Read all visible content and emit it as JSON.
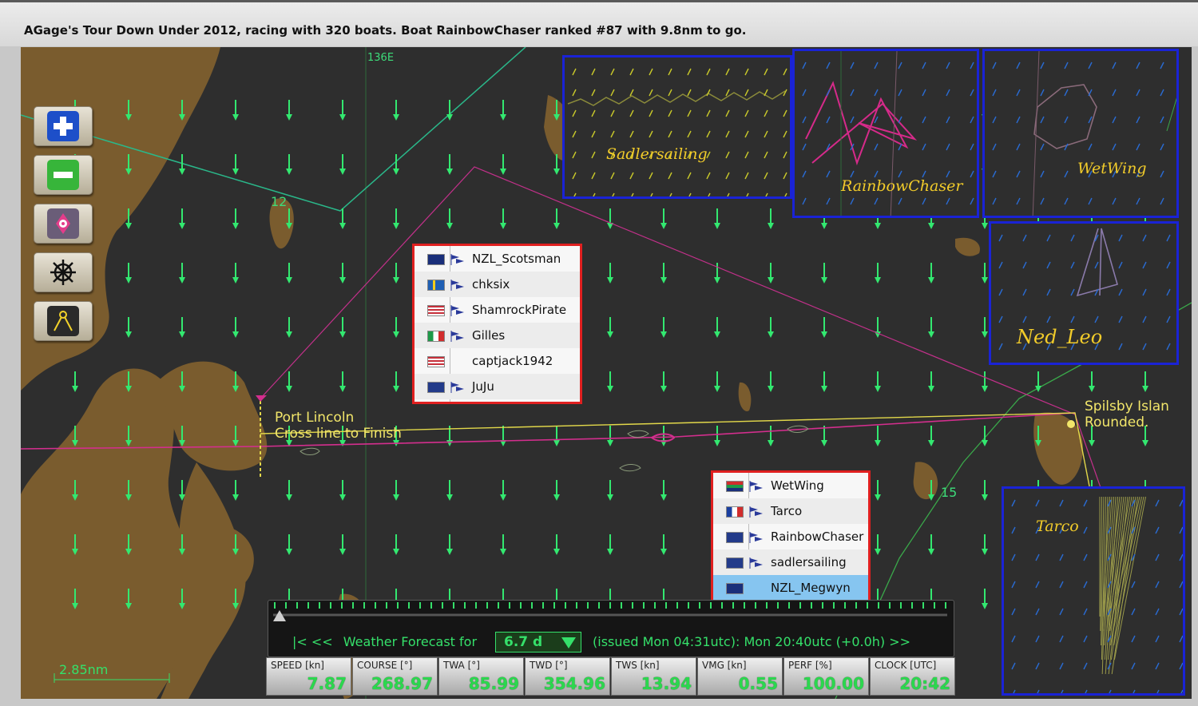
{
  "title": "AGage's Tour Down Under 2012, racing with 320 boats. Boat RainbowChaser ranked #87 with 9.8nm to go.",
  "map": {
    "grid_labels": {
      "lon": "136E",
      "n12": "12",
      "n15": "15"
    },
    "labels": {
      "port_lincoln": "Port Lincoln",
      "finish": "Cross line to Finish",
      "spilsby": "Spilsby Islan",
      "rounded": "Rounded."
    },
    "scale": "2.85nm"
  },
  "controls": [
    "zoom-in",
    "zoom-out",
    "compass",
    "helm",
    "waypoint"
  ],
  "popup_top": [
    {
      "flag": "nzl",
      "name": "NZL_Scotsman"
    },
    {
      "flag": "swe",
      "name": "chksix"
    },
    {
      "flag": "usa",
      "name": "ShamrockPirate"
    },
    {
      "flag": "ita",
      "name": "Gilles"
    },
    {
      "flag": "usa",
      "name": "captjack1942"
    },
    {
      "flag": "gbr",
      "name": "JuJu"
    }
  ],
  "popup_bottom": [
    {
      "flag": "rsa",
      "name": "WetWing"
    },
    {
      "flag": "fra",
      "name": "Tarco"
    },
    {
      "flag": "gbr",
      "name": "RainbowChaser"
    },
    {
      "flag": "gbr",
      "name": "sadlersailing"
    },
    {
      "flag": "nzl",
      "name": "NZL_Megwyn",
      "selected": true
    }
  ],
  "thumbs": {
    "sadlersailing": "Sadlersailing",
    "rainbowchaser": "RainbowChaser",
    "wetwing": "WetWing",
    "nedleo": "Ned_Leo",
    "tarco": "Tarco"
  },
  "timeline": {
    "nav_left": "|<  <<",
    "forecast_label": "Weather Forecast for",
    "forecast_value": "6.7 d",
    "issued": "(issued Mon 04:31utc): Mon 20:40utc  (+0.0h)  >>"
  },
  "stats": [
    {
      "label": "SPEED [kn]",
      "value": "7.87"
    },
    {
      "label": "COURSE [°]",
      "value": "268.97"
    },
    {
      "label": "TWA [°]",
      "value": "85.99"
    },
    {
      "label": "TWD [°]",
      "value": "354.96"
    },
    {
      "label": "TWS [kn]",
      "value": "13.94"
    },
    {
      "label": "VMG [kn]",
      "value": "0.55"
    },
    {
      "label": "PERF [%]",
      "value": "100.00"
    },
    {
      "label": "CLOCK [UTC]",
      "value": "20:42"
    }
  ],
  "colors": {
    "land": "#7a5c2e",
    "sea": "#2e2e2e",
    "wind": "#33e870",
    "thumb_border": "#1a23d6",
    "popup_border": "#e02020"
  }
}
